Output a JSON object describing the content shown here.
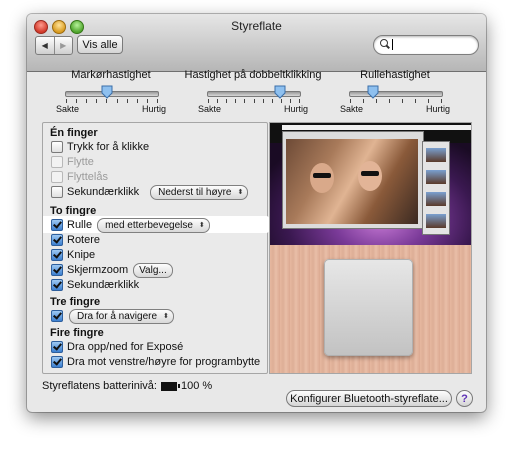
{
  "window": {
    "title": "Styreflate"
  },
  "toolbar": {
    "back_glyph": "◀",
    "forward_glyph": "▶",
    "show_all_label": "Vis alle",
    "search_value": ""
  },
  "sliders": [
    {
      "title": "Markørhastighet",
      "min_label": "Sakte",
      "max_label": "Hurtig",
      "value": 0.45,
      "ticks": 10
    },
    {
      "title": "Hastighet på dobbeltklikking",
      "min_label": "Sakte",
      "max_label": "Hurtig",
      "value": 0.78,
      "ticks": 11
    },
    {
      "title": "Rullehastighet",
      "min_label": "Sakte",
      "max_label": "Hurtig",
      "value": 0.25,
      "ticks": 8
    }
  ],
  "one_finger": {
    "heading": "Én finger",
    "tap_to_click": {
      "label": "Trykk for å klikke",
      "checked": false
    },
    "drag": {
      "label": "Flytte",
      "checked": false,
      "enabled": false
    },
    "drag_lock": {
      "label": "Flyttelås",
      "checked": false,
      "enabled": false
    },
    "secondary_click": {
      "label": "Sekundærklikk",
      "checked": false,
      "popup": "Nederst til høyre"
    }
  },
  "two_fingers": {
    "heading": "To fingre",
    "scroll": {
      "label": "Rulle",
      "checked": true,
      "popup": "med etterbevegelse"
    },
    "rotate": {
      "label": "Rotere",
      "checked": true
    },
    "pinch": {
      "label": "Knipe",
      "checked": true
    },
    "screen_zoom": {
      "label": "Skjermzoom",
      "checked": true,
      "button": "Valg..."
    },
    "secondary_click": {
      "label": "Sekundærklikk",
      "checked": true
    }
  },
  "three_fingers": {
    "heading": "Tre fingre",
    "navigate": {
      "checked": true,
      "popup": "Dra for å navigere"
    }
  },
  "four_fingers": {
    "heading": "Fire fingre",
    "expose": {
      "label": "Dra opp/ned for Exposé",
      "checked": true
    },
    "app_switch": {
      "label": "Dra mot venstre/høyre for programbytte",
      "checked": true
    }
  },
  "footer": {
    "battery_label": "Styreflatens batterinivå:",
    "battery_value": "100 %",
    "configure_button": "Konfigurer Bluetooth-styreflate...",
    "help_label": "?"
  },
  "icons": [
    "back-arrow-icon",
    "forward-arrow-icon",
    "search-icon",
    "battery-icon",
    "help-icon"
  ]
}
